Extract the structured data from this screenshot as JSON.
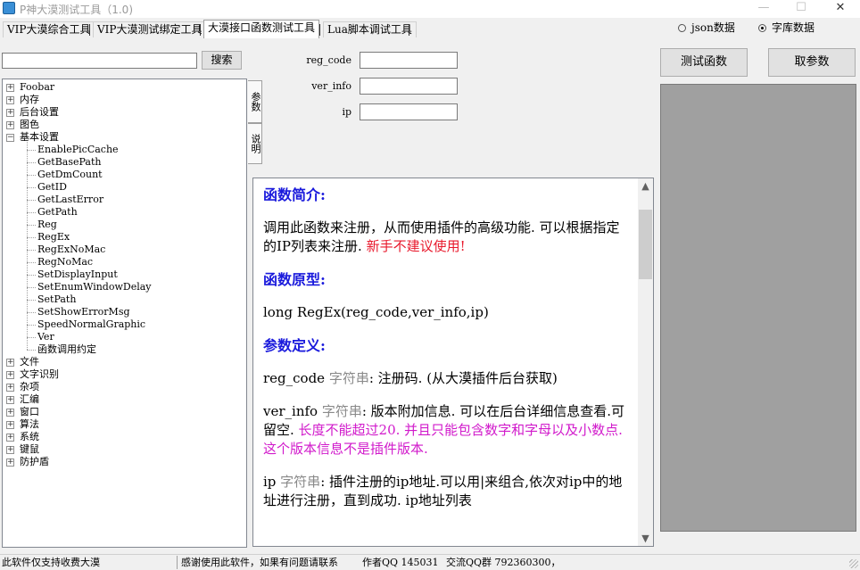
{
  "window": {
    "title": "P神大漠测试工具（1.0)"
  },
  "tabs": [
    {
      "label": "VIP大漠综合工具"
    },
    {
      "label": "VIP大漠测试绑定工具"
    },
    {
      "label": "大漠接口函数测试工具"
    },
    {
      "label": "Lua脚本调试工具"
    }
  ],
  "data_source": {
    "options": [
      "json数据",
      "字库数据"
    ],
    "selected": "字库数据"
  },
  "search": {
    "value": "",
    "button_label": "搜索"
  },
  "tree": {
    "groups_before": [
      "Foobar",
      "内存",
      "后台设置",
      "图色"
    ],
    "expanded_group": "基本设置",
    "children": [
      "EnablePicCache",
      "GetBasePath",
      "GetDmCount",
      "GetID",
      "GetLastError",
      "GetPath",
      "Reg",
      "RegEx",
      "RegExNoMac",
      "RegNoMac",
      "SetDisplayInput",
      "SetEnumWindowDelay",
      "SetPath",
      "SetShowErrorMsg",
      "SpeedNormalGraphic",
      "Ver",
      "函数调用约定"
    ],
    "groups_after": [
      "文件",
      "文字识别",
      "杂项",
      "汇编",
      "窗口",
      "算法",
      "系统",
      "键鼠",
      "防护盾"
    ]
  },
  "side_tabs": [
    "参数",
    "说明"
  ],
  "params": [
    {
      "label": "reg_code",
      "value": ""
    },
    {
      "label": "ver_info",
      "value": ""
    },
    {
      "label": "ip",
      "value": ""
    }
  ],
  "buttons": {
    "test": "测试函数",
    "get_params": "取参数"
  },
  "doc": {
    "intro_title": "函数简介:",
    "intro_text": "调用此函数来注册，从而使用插件的高级功能. 可以根据指定的IP列表来注册. ",
    "intro_warning": "新手不建议使用!",
    "proto_title": "函数原型:",
    "proto_text": "long RegEx(reg_code,ver_info,ip)",
    "params_title": "参数定义:",
    "p1_name": "reg_code ",
    "p1_type": "字符串",
    "p1_desc": ": 注册码. (从大漠插件后台获取)",
    "p2_name": "ver_info ",
    "p2_type": "字符串",
    "p2_desc": ": 版本附加信息. 可以在后台详细信息查看.可留空. ",
    "p2_warning": "长度不能超过20. 并且只能包含数字和字母以及小数点. 这个版本信息不是插件版本.",
    "p3_name": "ip ",
    "p3_type": "字符串",
    "p3_desc": ": 插件注册的ip地址.可以用|来组合,依次对ip中的地址进行注册，直到成功. ip地址列表"
  },
  "status": {
    "left": "此软件仅支持收费大漠",
    "thanks": "感谢使用此软件，如果有问题请联系",
    "author": "作者QQ 145031",
    "group": "交流QQ群 792360300，"
  }
}
